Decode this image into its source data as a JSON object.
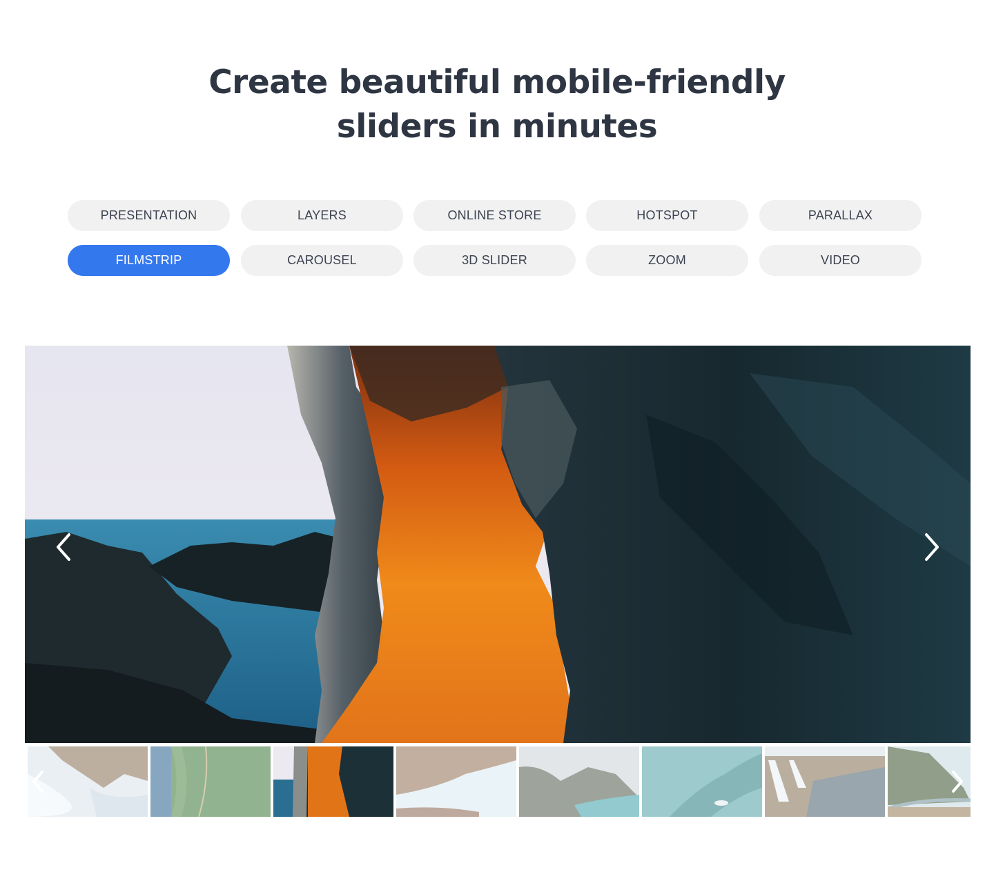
{
  "headline": {
    "line1": "Create beautiful mobile-friendly",
    "line2": "sliders in minutes"
  },
  "tabs": [
    {
      "label": "PRESENTATION",
      "active": false
    },
    {
      "label": "LAYERS",
      "active": false
    },
    {
      "label": "ONLINE STORE",
      "active": false
    },
    {
      "label": "HOTSPOT",
      "active": false
    },
    {
      "label": "PARALLAX",
      "active": false
    },
    {
      "label": "FILMSTRIP",
      "active": true
    },
    {
      "label": "CAROUSEL",
      "active": false
    },
    {
      "label": "3D SLIDER",
      "active": false
    },
    {
      "label": "ZOOM",
      "active": false
    },
    {
      "label": "VIDEO",
      "active": false
    }
  ],
  "colors": {
    "accent": "#3478ee",
    "tab_bg": "#f1f1f1",
    "headline": "#2f3643"
  },
  "slider": {
    "current_slide_description": "Orange-lit sea cave rock arch with ocean and sky on the left",
    "prev_icon": "chevron-left-icon",
    "next_icon": "chevron-right-icon"
  },
  "filmstrip": {
    "active_index": 2,
    "thumbnails": [
      {
        "description": "Aerial waves crashing on rocky coast"
      },
      {
        "description": "Aerial forest with path beside water"
      },
      {
        "description": "Orange-lit sea cave"
      },
      {
        "description": "Cliffs with surf in a cove"
      },
      {
        "description": "Mountain peaks over turquoise bay"
      },
      {
        "description": "Aerial turquoise water with boats"
      },
      {
        "description": "Waterfalls in a rocky landscape"
      },
      {
        "description": "Coastal highway bridge below green hill"
      }
    ],
    "prev_icon": "chevron-left-icon",
    "next_icon": "chevron-right-icon"
  }
}
